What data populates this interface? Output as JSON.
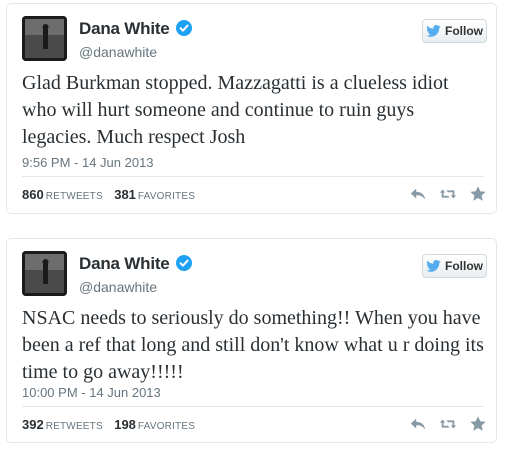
{
  "tweets": [
    {
      "name": "Dana White",
      "handle": "@danawhite",
      "follow_label": "Follow",
      "text": "Glad Burkman stopped. Mazzagatti is a clueless idiot who will hurt someone and continue to ruin guys legacies. Much respect Josh",
      "timestamp": "9:56 PM - 14 Jun 2013",
      "retweets": "860",
      "retweets_label": "RETWEETS",
      "favorites": "381",
      "favorites_label": "FAVORITES"
    },
    {
      "name": "Dana White",
      "handle": "@danawhite",
      "follow_label": "Follow",
      "text": "NSAC needs to seriously do something!! When you have been a ref that long and still don't know what u r doing its time to go away!!!!!",
      "timestamp": "10:00 PM - 14 Jun 2013",
      "retweets": "392",
      "retweets_label": "RETWEETS",
      "favorites": "198",
      "favorites_label": "FAVORITES"
    }
  ],
  "colors": {
    "verified": "#1da1f2",
    "twitter_bird": "#55acee",
    "muted": "#66757f",
    "icon": "#8899a6"
  },
  "icons": [
    "verified-badge-icon",
    "twitter-bird-icon",
    "reply-icon",
    "retweet-icon",
    "favorite-star-icon"
  ]
}
